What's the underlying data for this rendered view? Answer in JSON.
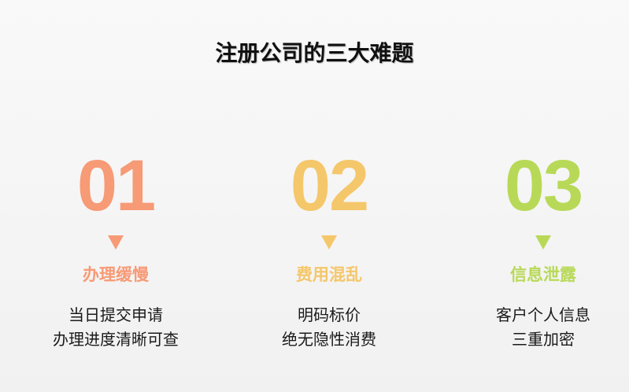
{
  "title": "注册公司的三大难题",
  "items": [
    {
      "number": "01",
      "heading": "办理缓慢",
      "lines": [
        "当日提交申请",
        "办理进度清晰可查"
      ],
      "color": "#f79a76"
    },
    {
      "number": "02",
      "heading": "费用混乱",
      "lines": [
        "明码标价",
        "绝无隐性消费"
      ],
      "color": "#f5c76b"
    },
    {
      "number": "03",
      "heading": "信息泄露",
      "lines": [
        "客户个人信息",
        "三重加密"
      ],
      "color": "#b8d957"
    }
  ],
  "icons": {
    "marker": "triangle-down-icon"
  }
}
